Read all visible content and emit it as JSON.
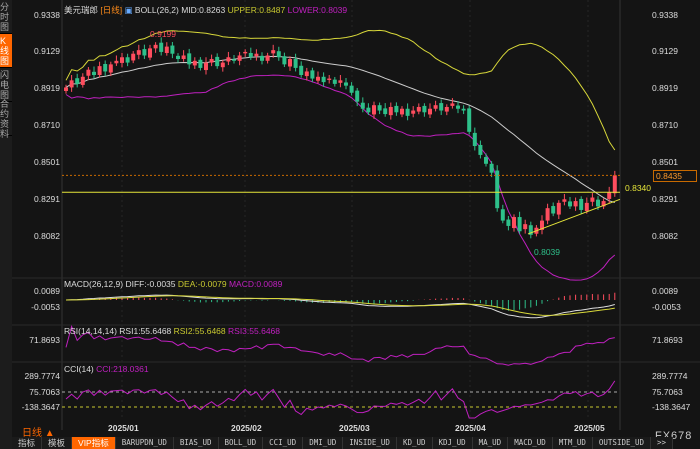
{
  "sidebar": {
    "items": [
      {
        "label": "分时图",
        "active": false
      },
      {
        "label": "K线图",
        "active": true
      },
      {
        "label": "闪电图",
        "active": false
      },
      {
        "label": "合约资料",
        "active": false
      }
    ]
  },
  "header": {
    "symbol": "美元瑞郎",
    "period": "[日线]",
    "boll": "BOLL(26,2)",
    "mid": "MID:0.8263",
    "upper": "UPPER:0.8487",
    "lower": "LOWER:0.8039"
  },
  "price_axis": {
    "labels": [
      "0.9338",
      "0.9129",
      "0.8919",
      "0.8710",
      "0.8501",
      "0.8291",
      "0.8082"
    ],
    "current": "0.8435",
    "line_label": "0.8340",
    "high_mark": "0.9199",
    "low_mark": "0.8039"
  },
  "macd": {
    "title": "MACD(26,12,9)",
    "diff": "DIFF:-0.0035",
    "dea": "DEA:-0.0079",
    "macd": "MACD:0.0089",
    "ticks": [
      "0.0089",
      "-0.0053"
    ]
  },
  "rsi": {
    "title": "RSI(14,14,14)",
    "rsi1": "RSI1:55.6468",
    "rsi2": "RSI2:55.6468",
    "rsi3": "RSI3:55.6468",
    "ticks": [
      "71.8693"
    ]
  },
  "cci": {
    "title": "CCI(14)",
    "cci": "CCI:218.0361",
    "ticks": [
      "289.7774",
      "75.7063",
      "-138.3647"
    ]
  },
  "dates": [
    "2025/01",
    "2025/02",
    "2025/03",
    "2025/04",
    "2025/05"
  ],
  "period_label": "日线 ▲",
  "tabs": [
    "指标",
    "模板",
    "VIP指标",
    "BARUPDN_UD",
    "BIAS_UD",
    "BOLL_UD",
    "CCI_UD",
    "DMI_UD",
    "INSIDE_UD",
    "KD_UD",
    "KDJ_UD",
    "MA_UD",
    "MACD_UD",
    "MTM_UD",
    "OUTSIDE_UD",
    ">>"
  ],
  "watermark": "FX678",
  "colors": {
    "up": "#ff4d5e",
    "down": "#2ec08a",
    "upper": "#d8d83a",
    "lower": "#c020c0",
    "mid": "#cccccc",
    "accent": "#ff6600"
  },
  "chart_data": {
    "type": "candlestick",
    "closes": [
      0.893,
      0.897,
      0.895,
      0.899,
      0.903,
      0.9,
      0.905,
      0.902,
      0.906,
      0.908,
      0.91,
      0.907,
      0.912,
      0.914,
      0.911,
      0.915,
      0.917,
      0.913,
      0.916,
      0.912,
      0.909,
      0.911,
      0.906,
      0.908,
      0.904,
      0.907,
      0.909,
      0.905,
      0.907,
      0.91,
      0.908,
      0.911,
      0.913,
      0.91,
      0.912,
      0.908,
      0.911,
      0.914,
      0.91,
      0.906,
      0.909,
      0.904,
      0.9,
      0.902,
      0.898,
      0.899,
      0.896,
      0.898,
      0.895,
      0.897,
      0.894,
      0.89,
      0.885,
      0.881,
      0.879,
      0.883,
      0.88,
      0.878,
      0.882,
      0.879,
      0.881,
      0.877,
      0.88,
      0.882,
      0.879,
      0.881,
      0.883,
      0.88,
      0.882,
      0.884,
      0.881,
      0.88,
      0.868,
      0.86,
      0.855,
      0.85,
      0.845,
      0.825,
      0.818,
      0.815,
      0.82,
      0.812,
      0.816,
      0.81,
      0.814,
      0.818,
      0.825,
      0.822,
      0.828,
      0.83,
      0.826,
      0.829,
      0.824,
      0.828,
      0.831,
      0.826,
      0.829,
      0.834,
      0.8435
    ],
    "ylim": [
      0.8082,
      0.9338
    ]
  }
}
